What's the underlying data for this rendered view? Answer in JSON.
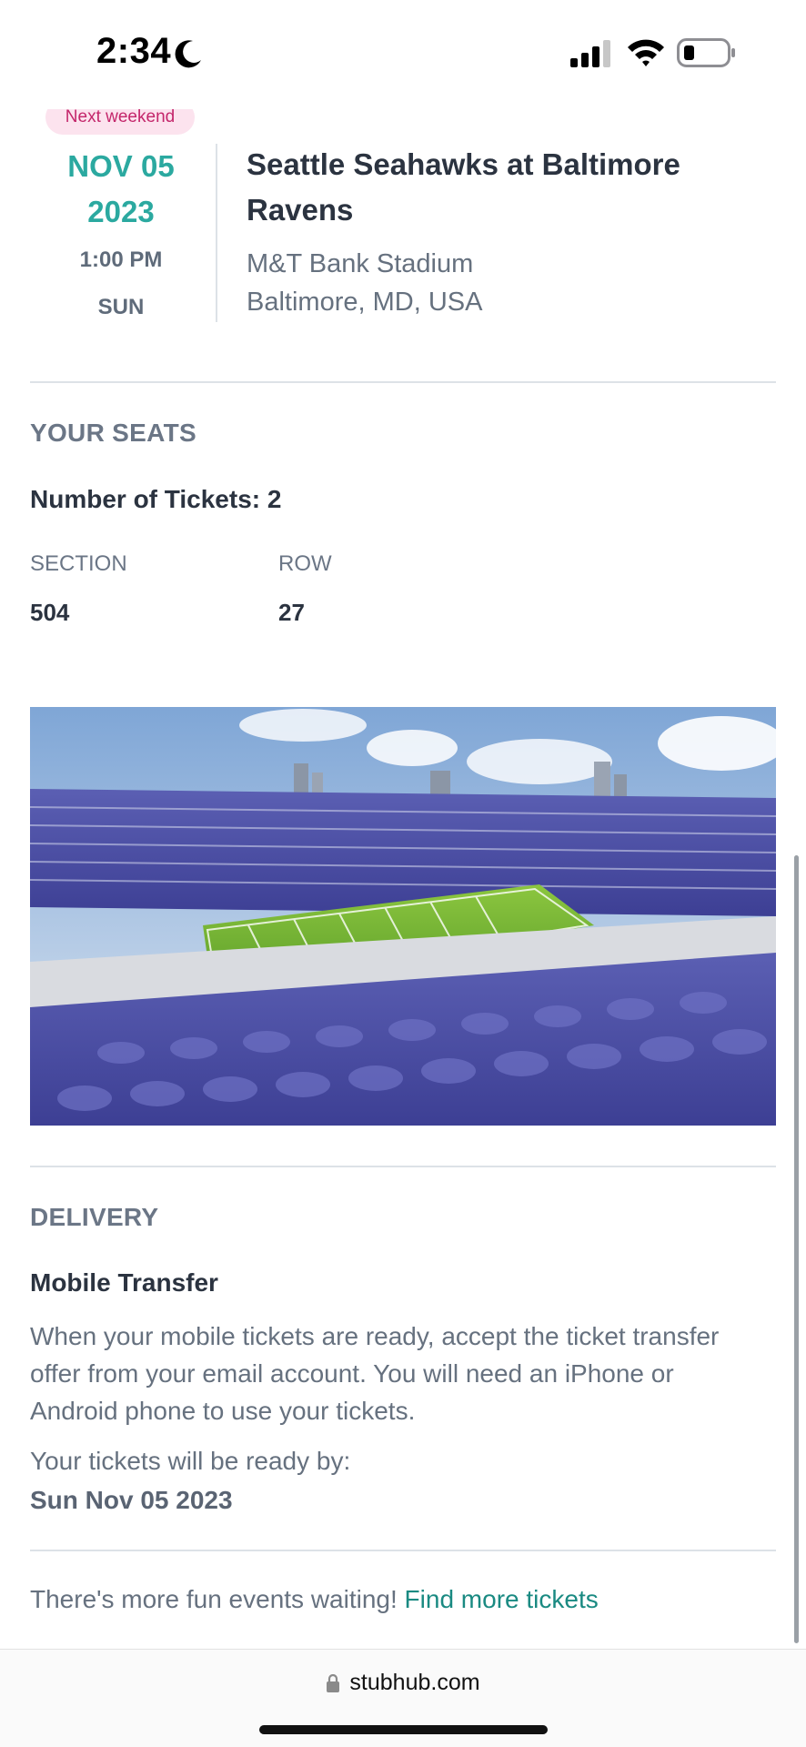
{
  "status_bar": {
    "time": "2:34"
  },
  "event": {
    "badge": "Next weekend",
    "month_day": "NOV 05",
    "year": "2023",
    "time": "1:00 PM",
    "weekday": "SUN",
    "title": "Seattle Seahawks at Baltimore Ravens",
    "venue": "M&T Bank Stadium",
    "location": "Baltimore, MD, USA"
  },
  "seats": {
    "heading": "YOUR SEATS",
    "tickets_label": "Number of Tickets: 2",
    "section_label": "SECTION",
    "section_value": "504",
    "row_label": "ROW",
    "row_value": "27"
  },
  "delivery": {
    "heading": "DELIVERY",
    "method": "Mobile Transfer",
    "description": "When your mobile tickets are ready, accept the ticket transfer offer from your email account. You will need an iPhone or Android phone to use your tickets.",
    "ready_label": "Your tickets will be ready by:",
    "ready_date": "Sun Nov 05 2023"
  },
  "footer": {
    "more_text": "There's more fun events waiting!",
    "more_link": "Find more tickets"
  },
  "browser": {
    "url": "stubhub.com"
  },
  "colors": {
    "accent_teal": "#2ba9a0",
    "link": "#1a8a82",
    "badge_bg": "#fce3ee",
    "badge_text": "#c4266b"
  }
}
